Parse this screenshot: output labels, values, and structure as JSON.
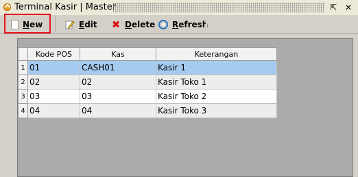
{
  "window": {
    "title": "Terminal Kasir | Master",
    "restore_glyph": "⇱",
    "close_glyph": "✕"
  },
  "toolbar": {
    "new_label": "New",
    "edit_label": "Edit",
    "delete_label": "Delete",
    "refresh_label": "Refresh",
    "delete_glyph": "✖"
  },
  "grid": {
    "columns": [
      "Kode POS",
      "Kas",
      "Keterangan"
    ],
    "rows": [
      {
        "num": "1",
        "kode_pos": "01",
        "kas": "CASH01",
        "keterangan": "Kasir 1"
      },
      {
        "num": "2",
        "kode_pos": "02",
        "kas": "02",
        "keterangan": "Kasir Toko 1"
      },
      {
        "num": "3",
        "kode_pos": "03",
        "kas": "03",
        "keterangan": "Kasir Toko 2"
      },
      {
        "num": "4",
        "kode_pos": "04",
        "kas": "04",
        "keterangan": "Kasir Toko 3"
      }
    ],
    "selected_row": 1
  },
  "colors": {
    "highlight": "#e8141c",
    "selected_row": "#a6cbf1",
    "app_icon": "#f0a020"
  }
}
